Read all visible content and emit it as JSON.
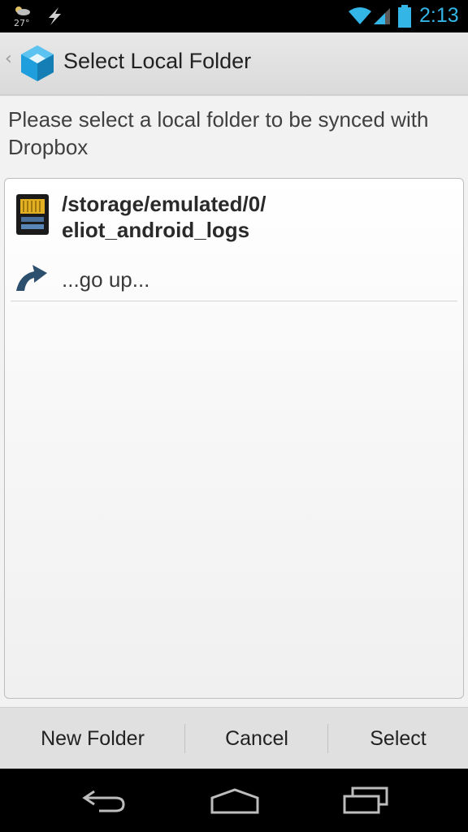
{
  "status_bar": {
    "temperature": "27°",
    "time": "2:13",
    "icons": [
      "weather-icon",
      "lightning-icon",
      "wifi-icon",
      "signal-icon",
      "battery-icon"
    ]
  },
  "action_bar": {
    "title": "Select Local Folder",
    "icons": [
      "up-caret-icon",
      "app-logo-icon"
    ]
  },
  "message": "Please select a local folder to be synced with Dropbox",
  "folder_list": {
    "current_path_line1": "/storage/emulated/0/",
    "current_path_line2": "eliot_android_logs",
    "go_up_label": "...go up..."
  },
  "buttons": {
    "new_folder": "New Folder",
    "cancel": "Cancel",
    "select": "Select"
  },
  "colors": {
    "clock": "#33b5e5",
    "status_bar": "#000000",
    "action_bar": "#e0e0e0",
    "app_icon": "#1fa0dd"
  }
}
